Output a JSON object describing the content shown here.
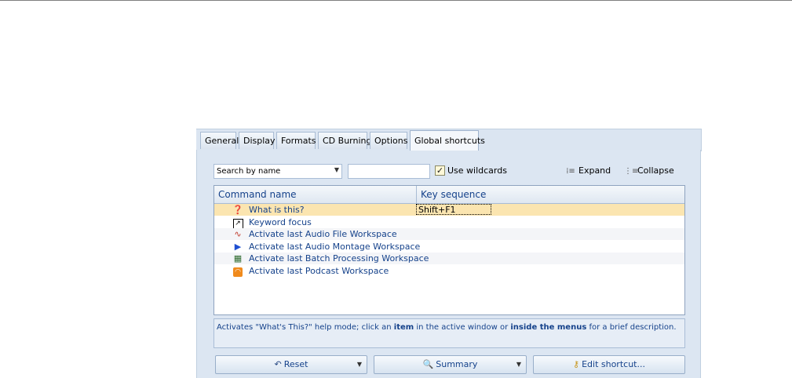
{
  "tabs": [
    "General",
    "Display",
    "Formats",
    "CD Burning",
    "Options",
    "Global shortcuts"
  ],
  "active_tab": "Global shortcuts",
  "search": {
    "mode_selected": "Search by name",
    "text": "",
    "use_wildcards_label": "Use wildcards",
    "use_wildcards_checked": true,
    "checkmark": "✓"
  },
  "tree_buttons": {
    "expand": "Expand",
    "collapse": "Collapse"
  },
  "grid": {
    "headers": {
      "command": "Command name",
      "key": "Key sequence"
    },
    "rows": [
      {
        "icon": "help-icon",
        "name": "What is this?",
        "key": "Shift+F1"
      },
      {
        "icon": "keyword-focus-icon",
        "name": "Keyword focus",
        "key": ""
      },
      {
        "icon": "audio-file-icon",
        "name": "Activate last Audio File Workspace",
        "key": ""
      },
      {
        "icon": "audio-montage-icon",
        "name": "Activate last Audio Montage Workspace",
        "key": ""
      },
      {
        "icon": "batch-processing-icon",
        "name": "Activate last Batch Processing Workspace",
        "key": ""
      },
      {
        "icon": "podcast-icon",
        "name": "Activate last Podcast Workspace",
        "key": ""
      }
    ]
  },
  "description": {
    "part1": "Activates \"What's This?\" help mode; click an ",
    "bold1": "item",
    "part2": " in the active window or ",
    "bold2": "inside the menus",
    "part3": " for a brief description."
  },
  "buttons": {
    "reset": "Reset",
    "summary": "Summary",
    "edit_shortcut": "Edit shortcut..."
  },
  "colors": {
    "panel_bg": "#dce6f2",
    "selection": "#fbe5b0",
    "text_blue": "#15428b"
  }
}
